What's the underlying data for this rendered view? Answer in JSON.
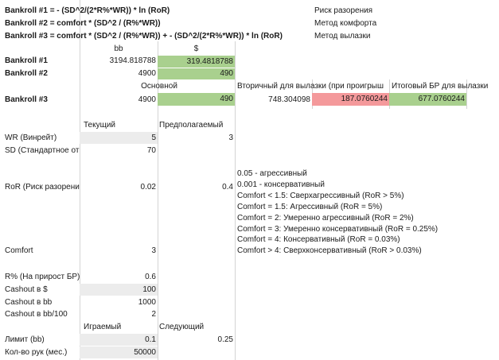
{
  "formulas": {
    "br1": "Bankroll #1 = - (SD^2/(2*R%*WR)) * ln (RoR)",
    "br2": "Bankroll #2 = comfort * (SD^2 / (R%*WR))",
    "br3": "Bankroll #3 = comfort * (SD^2 / (R%*WR)) + - (SD^2/(2*R%*WR)) * ln (RoR)"
  },
  "methods": {
    "risk": "Риск разорения",
    "comfort": "Метод комфорта",
    "cashout": "Метод вылазки"
  },
  "units": {
    "bb": "bb",
    "dollar": "$"
  },
  "bankroll1": {
    "label": "Bankroll #1",
    "bb": "3194.818788",
    "usd": "319.4818788"
  },
  "bankroll2": {
    "label": "Bankroll #2",
    "bb": "4900",
    "usd": "490"
  },
  "bankroll3": {
    "header_main": "Основной",
    "header_secondary": "Вторичный для вылазки (при проигрыш",
    "header_total": "Итоговый БР для вылазки",
    "label": "Bankroll #3",
    "bb": "4900",
    "usd": "490",
    "secondary_bb": "748.304098",
    "secondary_usd": "187.0760244",
    "total_usd": "677.0760244"
  },
  "params": {
    "col_current": "Текущий",
    "col_expected": "Предполагаемый",
    "wr_label": "WR (Винрейт)",
    "wr_current": "5",
    "wr_expected": "3",
    "sd_label": "SD (Стандартное от",
    "sd_current": "70",
    "ror_label": "RoR (Риск разорени",
    "ror_current": "0.02",
    "ror_expected": "0.4",
    "comfort_label": "Comfort",
    "comfort_current": "3"
  },
  "notes": [
    "0.05 - агрессивный",
    "0.001 - консервативный",
    "Comfort < 1.5: Сверхагрессивный (RoR > 5%)",
    "Comfort = 1.5: Агрессивный (RoR = 5%)",
    "Comfort = 2: Умеренно агрессивный (RoR = 2%)",
    "Comfort = 3: Умеренно консервативный (RoR = 0.25%)",
    "Comfort = 4: Консервативный (RoR = 0.03%)",
    "Comfort > 4: Сверхконсервативный (RoR > 0.03%)"
  ],
  "cash": {
    "r_label": "R% (На прирост БР)",
    "r_value": "0.6",
    "usd_label": "Cashout в $",
    "usd_value": "100",
    "bb_label": "Cashout в bb",
    "bb_value": "1000",
    "bb100_label": "Cashout в bb/100",
    "bb100_value": "2"
  },
  "limits": {
    "col_playing": "Играемый",
    "col_next": "Следующий",
    "limit_label": "Лимит (bb)",
    "limit_playing": "0.1",
    "limit_next": "0.25",
    "hands_label": "Кол-во рук (мес.)",
    "hands_value": "50000"
  },
  "colors": {
    "green": "#a9d08e",
    "red": "#f4999b",
    "gray": "#ececec",
    "gridline": "#d4d4d4"
  }
}
